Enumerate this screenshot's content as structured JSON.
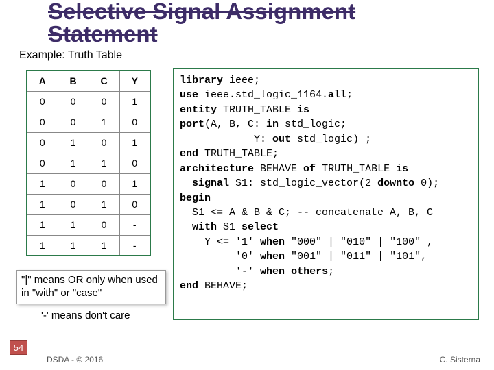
{
  "title_line1": "Selective Signal Assignment",
  "title_line2": "Statement",
  "subtitle": "Example: Truth Table",
  "table": {
    "header": [
      "A",
      "B",
      "C",
      "Y"
    ],
    "rows": [
      [
        "0",
        "0",
        "0",
        "1"
      ],
      [
        "0",
        "0",
        "1",
        "0"
      ],
      [
        "0",
        "1",
        "0",
        "1"
      ],
      [
        "0",
        "1",
        "1",
        "0"
      ],
      [
        "1",
        "0",
        "0",
        "1"
      ],
      [
        "1",
        "0",
        "1",
        "0"
      ],
      [
        "1",
        "1",
        "0",
        "-"
      ],
      [
        "1",
        "1",
        "1",
        "-"
      ]
    ]
  },
  "code": [
    {
      "t": "library",
      "k": [
        "library"
      ]
    },
    {
      "t": " ieee;"
    },
    {
      "br": 1
    },
    {
      "t": "use",
      "k": [
        "use"
      ]
    },
    {
      "t": " ieee.std_logic_1164."
    },
    {
      "t": "all",
      "k": [
        "all"
      ]
    },
    {
      "t": ";"
    },
    {
      "br": 1
    },
    {
      "t": "entity",
      "k": [
        "entity"
      ]
    },
    {
      "t": " TRUTH_TABLE "
    },
    {
      "t": "is",
      "k": [
        "is"
      ]
    },
    {
      "br": 1
    },
    {
      "t": "port",
      "k": [
        "port"
      ]
    },
    {
      "t": "(A, B, C: "
    },
    {
      "t": "in",
      "k": [
        "in"
      ]
    },
    {
      "t": " std_logic;"
    },
    {
      "br": 1
    },
    {
      "t": "            Y: "
    },
    {
      "t": "out",
      "k": [
        "out"
      ]
    },
    {
      "t": " std_logic) ;"
    },
    {
      "br": 1
    },
    {
      "t": "end",
      "k": [
        "end"
      ]
    },
    {
      "t": " TRUTH_TABLE;"
    },
    {
      "br": 1
    },
    {
      "t": "architecture",
      "k": [
        "architecture"
      ]
    },
    {
      "t": " BEHAVE "
    },
    {
      "t": "of",
      "k": [
        "of"
      ]
    },
    {
      "t": " TRUTH_TABLE "
    },
    {
      "t": "is",
      "k": [
        "is"
      ]
    },
    {
      "br": 1
    },
    {
      "t": "  signal",
      "k": [
        "signal"
      ]
    },
    {
      "t": " S1: std_logic_vector(2 "
    },
    {
      "t": "downto",
      "k": [
        "downto"
      ]
    },
    {
      "t": " 0);"
    },
    {
      "br": 1
    },
    {
      "t": "begin",
      "k": [
        "begin"
      ]
    },
    {
      "br": 1
    },
    {
      "t": "  S1 <= A & B & C; -- concatenate A, B, C"
    },
    {
      "br": 1
    },
    {
      "t": "  with",
      "k": [
        "with"
      ]
    },
    {
      "t": " S1 "
    },
    {
      "t": "select",
      "k": [
        "select"
      ]
    },
    {
      "br": 1
    },
    {
      "t": "    Y <= '1' "
    },
    {
      "t": "when",
      "k": [
        "when"
      ]
    },
    {
      "t": " \"000\" | \"010\" | \"100\" ,"
    },
    {
      "br": 1
    },
    {
      "t": "         '0' "
    },
    {
      "t": "when",
      "k": [
        "when"
      ]
    },
    {
      "t": " \"001\" | \"011\" | \"101\","
    },
    {
      "br": 1
    },
    {
      "t": "         '-' "
    },
    {
      "t": "when others",
      "k": [
        "when",
        "others"
      ]
    },
    {
      "t": ";"
    },
    {
      "br": 1
    },
    {
      "t": "end",
      "k": [
        "end"
      ]
    },
    {
      "t": " BEHAVE;"
    }
  ],
  "note1": "\"|\" means OR only when used in \"with\" or \"case\"",
  "note2": "'-' means don't care",
  "page_num": "54",
  "footer_left": "DSDA - © 2016",
  "footer_right": "C. Sisterna"
}
